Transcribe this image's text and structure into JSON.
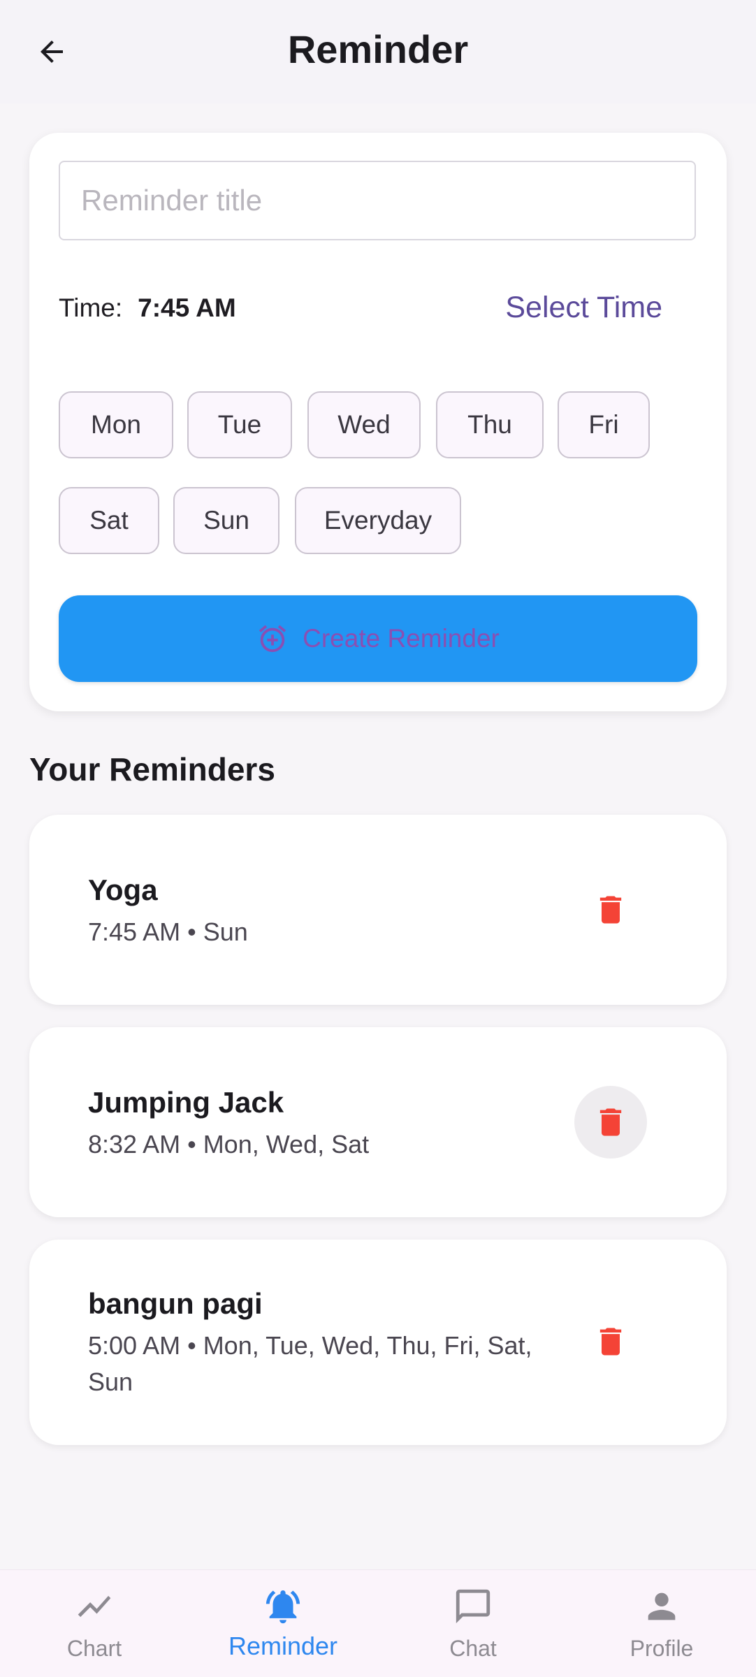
{
  "header": {
    "title": "Reminder",
    "back_icon": "arrow-left-icon"
  },
  "form": {
    "title_placeholder": "Reminder title",
    "title_value": "",
    "time_label": "Time:",
    "time_value": "7:45 AM",
    "select_time_label": "Select Time",
    "days": [
      "Mon",
      "Tue",
      "Wed",
      "Thu",
      "Fri",
      "Sat",
      "Sun",
      "Everyday"
    ],
    "create_button": {
      "label": "Create Reminder",
      "icon": "alarm-add-icon"
    }
  },
  "reminders_section": {
    "title": "Your Reminders",
    "items": [
      {
        "title": "Yoga",
        "subtitle": "7:45 AM • Sun"
      },
      {
        "title": "Jumping Jack",
        "subtitle": "8:32 AM • Mon, Wed, Sat"
      },
      {
        "title": "bangun pagi",
        "subtitle": "5:00 AM • Mon, Tue, Wed, Thu, Fri, Sat, Sun"
      }
    ]
  },
  "bottom_nav": {
    "items": [
      {
        "label": "Chart",
        "icon": "chart-line-icon",
        "active": false
      },
      {
        "label": "Reminder",
        "icon": "bell-icon",
        "active": true
      },
      {
        "label": "Chat",
        "icon": "chat-bubble-icon",
        "active": false
      },
      {
        "label": "Profile",
        "icon": "person-icon",
        "active": false
      }
    ]
  },
  "colors": {
    "accent": "#2196F3",
    "select_time": "#5B4A9A",
    "create_label": "#8A4FB3",
    "delete": "#F44336",
    "nav_active": "#2E87EF"
  }
}
